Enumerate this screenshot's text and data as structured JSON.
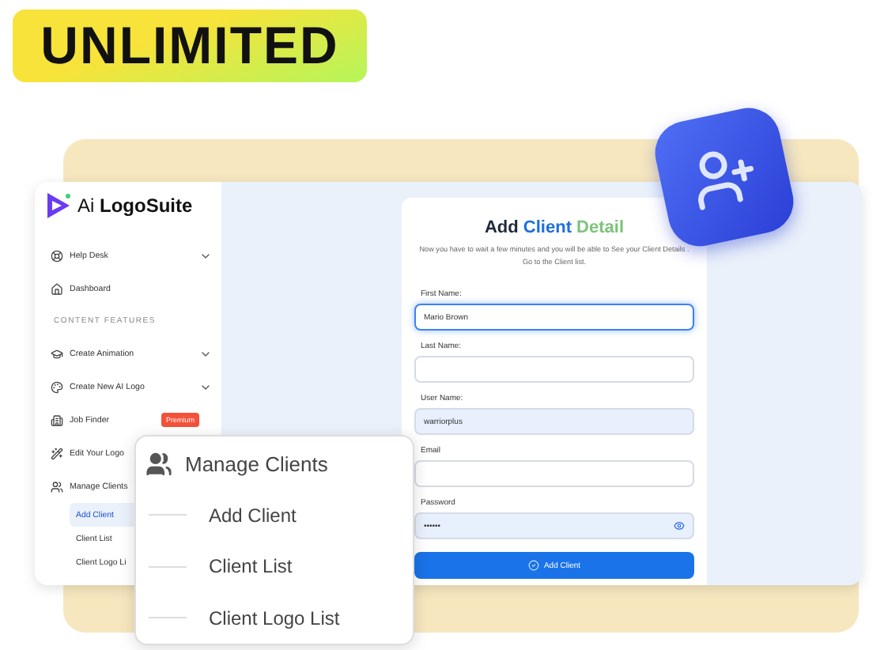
{
  "banner": {
    "text": "UNLIMITED"
  },
  "app": {
    "logo": {
      "prefix": "Ai",
      "name": "LogoSuite"
    },
    "sidebar": [
      {
        "kind": "item",
        "label": "Help Desk",
        "expandable": true
      },
      {
        "kind": "item",
        "label": "Dashboard",
        "expandable": false
      },
      {
        "kind": "section",
        "label": "CONTENT FEATURES"
      },
      {
        "kind": "item",
        "label": "Create Animation",
        "expandable": true
      },
      {
        "kind": "item",
        "label": "Create New AI Logo",
        "expandable": true
      },
      {
        "kind": "item",
        "label": "Job Finder",
        "expandable": false,
        "badge": "Premium"
      },
      {
        "kind": "item",
        "label": "Edit Your Logo"
      },
      {
        "kind": "item",
        "label": "Manage Clients",
        "expandable": false,
        "children": [
          {
            "label": "Add Client",
            "selected": true
          },
          {
            "label": "Client List",
            "selected": false
          },
          {
            "label": "Client Logo Li",
            "selected": false
          }
        ]
      }
    ],
    "form": {
      "title_parts": [
        {
          "text": "Add ",
          "color": "#1e293b"
        },
        {
          "text": "Client ",
          "color": "#1d6fe0"
        },
        {
          "text": "Detail",
          "color": "#7cc47a"
        }
      ],
      "subtitle": "Now you have to wait a few minutes and you will be able to See your Client Details . Go to the Client list.",
      "fields": [
        {
          "kind": "text",
          "label": "First Name:",
          "value": "Mario Brown",
          "focused": true,
          "filled": false
        },
        {
          "kind": "text",
          "label": "Last Name:",
          "focused": false,
          "filled": false
        },
        {
          "kind": "text",
          "label": "User Name:",
          "value": "warriorplus",
          "focused": false,
          "filled": true
        },
        {
          "kind": "text",
          "label": "Email",
          "focused": false,
          "filled": false
        },
        {
          "kind": "password",
          "label": "Password",
          "value": "••••••",
          "focused": false,
          "filled": true
        }
      ],
      "button": "Add Client"
    }
  },
  "popup": {
    "title": "Manage Clients",
    "items": [
      "Add Client",
      "Client List",
      "Client Logo List"
    ]
  }
}
